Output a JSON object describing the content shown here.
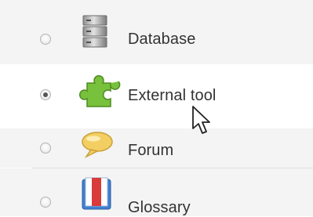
{
  "activity_chooser": {
    "items": [
      {
        "label": "Database",
        "icon": "database-icon",
        "selected": false
      },
      {
        "label": "External tool",
        "icon": "puzzle-piece-icon",
        "selected": true
      },
      {
        "label": "Forum",
        "icon": "speech-bubble-icon",
        "selected": false
      },
      {
        "label": "Glossary",
        "icon": "book-icon",
        "selected": false
      }
    ]
  },
  "colors": {
    "row_background": "#f4f4f4",
    "selected_row_background": "#ffffff",
    "separator": "#dedede",
    "label_text": "#333333",
    "puzzle_green": "#78c13c",
    "bubble_yellow": "#f3cf63",
    "book_red": "#d93a3a",
    "book_blue": "#3f7fd0"
  }
}
